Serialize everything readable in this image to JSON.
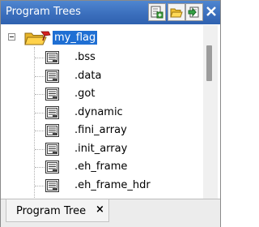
{
  "window": {
    "title": "Program Trees",
    "buttons": [
      {
        "name": "new-tree-icon",
        "tooltip": ""
      },
      {
        "name": "open-folder-icon",
        "tooltip": ""
      },
      {
        "name": "select-tree-icon",
        "tooltip": ""
      },
      {
        "name": "close-icon",
        "tooltip": ""
      }
    ]
  },
  "tree": {
    "root": {
      "label": "my_flag",
      "expanded": true,
      "selected": true,
      "icon": "folder-open-icon"
    },
    "children": [
      {
        "label": ".bss",
        "icon": "fragment-icon"
      },
      {
        "label": ".data",
        "icon": "fragment-icon"
      },
      {
        "label": ".got",
        "icon": "fragment-icon"
      },
      {
        "label": ".dynamic",
        "icon": "fragment-icon"
      },
      {
        "label": ".fini_array",
        "icon": "fragment-icon"
      },
      {
        "label": ".init_array",
        "icon": "fragment-icon"
      },
      {
        "label": ".eh_frame",
        "icon": "fragment-icon"
      },
      {
        "label": ".eh_frame_hdr",
        "icon": "fragment-icon"
      }
    ]
  },
  "tabs": [
    {
      "label": "Program Tree",
      "close_glyph": "×",
      "active": true
    }
  ],
  "colors": {
    "titlebar": "#3b6fbd",
    "selection": "#1f6fd3",
    "tab_background": "#f4f4f4"
  }
}
